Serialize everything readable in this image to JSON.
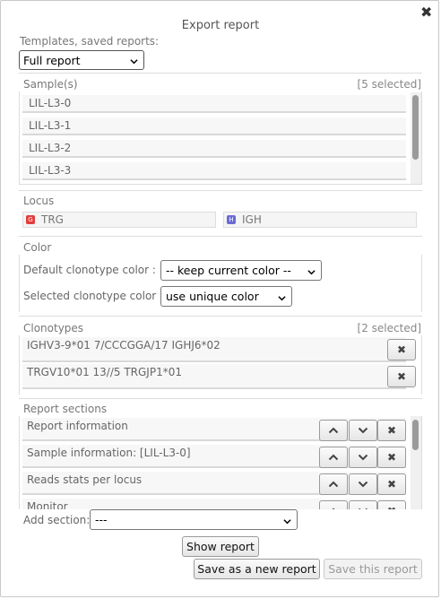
{
  "dialog": {
    "title": "Export report",
    "close_glyph": "✖",
    "close_icon": "close-icon"
  },
  "templates": {
    "label": "Templates, saved reports:",
    "selected": "Full report",
    "chevron_icon": "chevron-down-icon"
  },
  "samples": {
    "label": "Sample(s)",
    "counter": "[5 selected]",
    "items": [
      "LIL-L3-0",
      "LIL-L3-1",
      "LIL-L3-2",
      "LIL-L3-3"
    ]
  },
  "locus": {
    "label": "Locus",
    "items": [
      {
        "badge": "G",
        "name": "TRG",
        "color": "#e43c3c"
      },
      {
        "badge": "H",
        "name": "IGH",
        "color": "#6b6bd4"
      }
    ]
  },
  "color": {
    "label": "Color",
    "default_label": "Default clonotype color :",
    "default_value": "-- keep current color --",
    "selected_label": "Selected clonotype color :",
    "selected_value": "use unique color"
  },
  "clonotypes": {
    "label": "Clonotypes",
    "counter": "[2 selected]",
    "items": [
      "IGHV3-9*01 7/CCCGGA/17 IGHJ6*02",
      "TRGV10*01 13//5 TRGJP1*01"
    ],
    "remove_glyph": "✖",
    "remove_icon": "close-icon"
  },
  "sections": {
    "label": "Report sections",
    "items": [
      "Report information",
      "Sample information: [LIL-L3-0]",
      "Reads stats per locus",
      "Monitor"
    ],
    "up_icon": "chevron-up-icon",
    "down_icon": "chevron-down-icon",
    "remove_glyph": "✖",
    "remove_icon": "close-icon"
  },
  "add_section": {
    "label": "Add section:",
    "selected": "---"
  },
  "actions": {
    "show_report": "Show report",
    "save_new": "Save as a new report",
    "save_this": "Save this report"
  }
}
